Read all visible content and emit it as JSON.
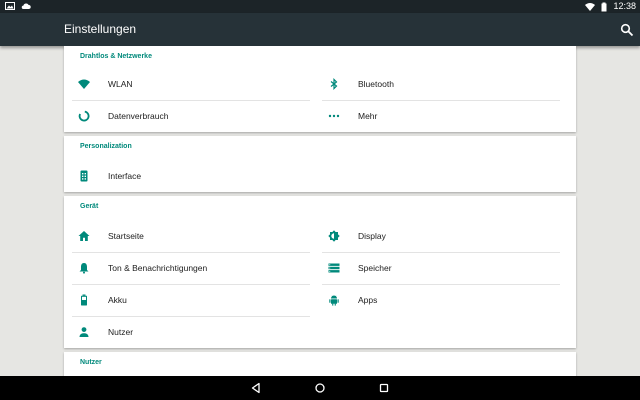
{
  "status_bar": {
    "time": "12:38",
    "icons": [
      "image-icon",
      "cloud-icon",
      "wifi-icon",
      "battery-icon"
    ]
  },
  "app_bar": {
    "title": "Einstellungen",
    "search_icon": "search-icon"
  },
  "sections": [
    {
      "title": "Drahtlos & Netzwerke",
      "items": [
        {
          "label": "WLAN",
          "icon": "wifi-icon"
        },
        {
          "label": "Bluetooth",
          "icon": "bluetooth-icon"
        },
        {
          "label": "Datenverbrauch",
          "icon": "data-usage-icon"
        },
        {
          "label": "Mehr",
          "icon": "more-dots-icon"
        }
      ]
    },
    {
      "title": "Personalization",
      "items": [
        {
          "label": "Interface",
          "icon": "interface-icon"
        }
      ]
    },
    {
      "title": "Gerät",
      "items": [
        {
          "label": "Startseite",
          "icon": "home-icon"
        },
        {
          "label": "Display",
          "icon": "brightness-icon"
        },
        {
          "label": "Ton & Benachrichtigungen",
          "icon": "bell-icon"
        },
        {
          "label": "Speicher",
          "icon": "storage-icon"
        },
        {
          "label": "Akku",
          "icon": "battery-icon"
        },
        {
          "label": "Apps",
          "icon": "android-icon"
        },
        {
          "label": "Nutzer",
          "icon": "person-icon"
        }
      ]
    },
    {
      "title": "Nutzer",
      "items": []
    }
  ],
  "nav_bar": {
    "buttons": [
      "back-icon",
      "home-circle-icon",
      "recents-icon"
    ]
  },
  "colors": {
    "status_bar": "#1c2428",
    "app_bar": "#263238",
    "accent": "#00897b",
    "background": "#e6e6e3",
    "nav_bar": "#000000"
  }
}
